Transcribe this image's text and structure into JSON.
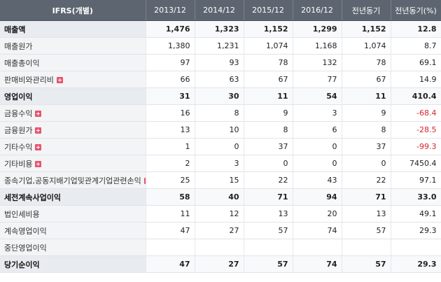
{
  "table": {
    "headers": [
      "IFRS(개별)",
      "2013/12",
      "2014/12",
      "2015/12",
      "2016/12",
      "전년동기",
      "전년동기(%)"
    ],
    "rows": [
      {
        "label": "매출액",
        "values": [
          "1,476",
          "1,323",
          "1,152",
          "1,299",
          "1,152",
          "12.8"
        ],
        "bold": true,
        "expand": false
      },
      {
        "label": "매출원가",
        "values": [
          "1,380",
          "1,231",
          "1,074",
          "1,168",
          "1,074",
          "8.7"
        ],
        "bold": false,
        "expand": false
      },
      {
        "label": "매출총이익",
        "values": [
          "97",
          "93",
          "78",
          "132",
          "78",
          "69.1"
        ],
        "bold": false,
        "expand": false
      },
      {
        "label": "판매비와관리비",
        "values": [
          "66",
          "63",
          "67",
          "77",
          "67",
          "14.9"
        ],
        "bold": false,
        "expand": true
      },
      {
        "label": "영업이익",
        "values": [
          "31",
          "30",
          "11",
          "54",
          "11",
          "410.4"
        ],
        "bold": true,
        "expand": false
      },
      {
        "label": "금융수익",
        "values": [
          "16",
          "8",
          "9",
          "3",
          "9",
          "-68.4"
        ],
        "bold": false,
        "expand": true
      },
      {
        "label": "금융원가",
        "values": [
          "13",
          "10",
          "8",
          "6",
          "8",
          "-28.5"
        ],
        "bold": false,
        "expand": true
      },
      {
        "label": "기타수익",
        "values": [
          "1",
          "0",
          "37",
          "0",
          "37",
          "-99.3"
        ],
        "bold": false,
        "expand": true
      },
      {
        "label": "기타비용",
        "values": [
          "2",
          "3",
          "0",
          "0",
          "0",
          "7450.4"
        ],
        "bold": false,
        "expand": true
      },
      {
        "label": "종속기업,공동지배기업및관계기업관련손익",
        "values": [
          "25",
          "15",
          "22",
          "43",
          "22",
          "97.1"
        ],
        "bold": false,
        "expand": true
      },
      {
        "label": "세전계속사업이익",
        "values": [
          "58",
          "40",
          "71",
          "94",
          "71",
          "33.0"
        ],
        "bold": true,
        "expand": false
      },
      {
        "label": "법인세비용",
        "values": [
          "11",
          "12",
          "13",
          "20",
          "13",
          "49.1"
        ],
        "bold": false,
        "expand": false
      },
      {
        "label": "계속영업이익",
        "values": [
          "47",
          "27",
          "57",
          "74",
          "57",
          "29.3"
        ],
        "bold": false,
        "expand": false
      },
      {
        "label": "중단영업이익",
        "values": [
          "",
          "",
          "",
          "",
          "",
          ""
        ],
        "bold": false,
        "expand": false
      },
      {
        "label": "당기순이익",
        "values": [
          "47",
          "27",
          "57",
          "74",
          "57",
          "29.3"
        ],
        "bold": true,
        "expand": false
      }
    ],
    "colors": {
      "header_bg": "#5d6670",
      "negative": "#d8232a",
      "expand_icon": "#e8546c"
    }
  }
}
